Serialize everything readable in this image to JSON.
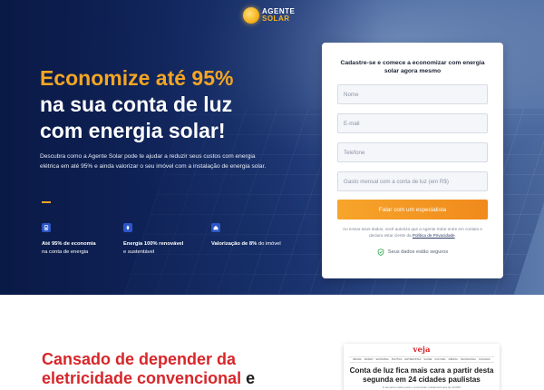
{
  "brand": {
    "name_line1": "Agente",
    "name_line2": "Solar"
  },
  "hero": {
    "headline_accent": "Economize até 95%",
    "headline_line2": "na sua conta de luz",
    "headline_line3": "com energia solar!",
    "lead": "Descubra como a Agente Solar pode te ajudar a reduzir seus custos com energia elétrica em até 95% e ainda valorizar o seu imóvel com a instalação de energia solar.",
    "features": [
      {
        "icon": "battery-icon",
        "strong": "Até 95% de economia",
        "rest": "na conta de energia"
      },
      {
        "icon": "leaf-icon",
        "strong": "Energia 100% renovável",
        "rest": "e sustentável"
      },
      {
        "icon": "house-icon",
        "strong": "Valorização de 8%",
        "rest": " do imóvel"
      }
    ]
  },
  "form": {
    "title": "Cadastre-se e comece a economizar com energia solar agora mesmo",
    "name_placeholder": "Nome",
    "email_placeholder": "E-mail",
    "phone_placeholder": "Telefone",
    "spend_placeholder": "Gasto mensal com a conta de luz (em R$)",
    "cta_label": "Falar com um especialista",
    "fine_print": "Ao enviar seus dados, você autoriza que a Agente Solar entre em contato e declara estar ciente da ",
    "privacy_link": "Política de Privacidade",
    "fine_end": ".",
    "secure_text": "Seus dados estão seguros"
  },
  "section2": {
    "title_line1": "Cansado de depender da",
    "title_line2_red": "eletricidade convencional",
    "title_line2_dark": " e"
  },
  "news": {
    "masthead": "veja",
    "nav": [
      "Brasil",
      "Mundo",
      "Economia",
      "Política",
      "Entrevistas",
      "Saúde",
      "Cultura",
      "Ciência",
      "Tecnologia",
      "Colunas"
    ],
    "headline": "Conta de luz fica mais cara a partir desta segunda em 24 cidades paulistas",
    "sub": "O aumento médio para o consumidor residencial será de 13,69%"
  },
  "colors": {
    "accent": "#F5A623",
    "navy": "#13296A",
    "red": "#D7262A",
    "icon_blue": "#2C56C8"
  }
}
